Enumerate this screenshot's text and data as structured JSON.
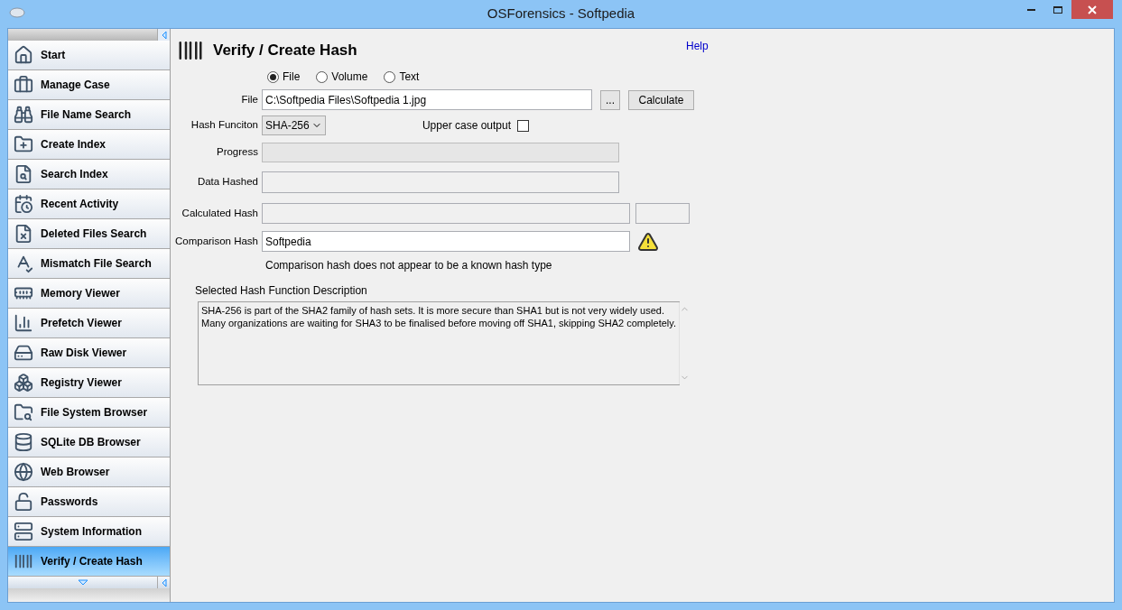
{
  "window": {
    "title": "OSForensics - Softpedia"
  },
  "sidebar": {
    "items": [
      {
        "label": "Start",
        "selected": false
      },
      {
        "label": "Manage Case",
        "selected": false
      },
      {
        "label": "File Name Search",
        "selected": false
      },
      {
        "label": "Create Index",
        "selected": false
      },
      {
        "label": "Search Index",
        "selected": false
      },
      {
        "label": "Recent Activity",
        "selected": false
      },
      {
        "label": "Deleted Files Search",
        "selected": false
      },
      {
        "label": "Mismatch File Search",
        "selected": false
      },
      {
        "label": "Memory Viewer",
        "selected": false
      },
      {
        "label": "Prefetch Viewer",
        "selected": false
      },
      {
        "label": "Raw Disk Viewer",
        "selected": false
      },
      {
        "label": "Registry Viewer",
        "selected": false
      },
      {
        "label": "File System Browser",
        "selected": false
      },
      {
        "label": "SQLite DB Browser",
        "selected": false
      },
      {
        "label": "Web Browser",
        "selected": false
      },
      {
        "label": "Passwords",
        "selected": false
      },
      {
        "label": "System Information",
        "selected": false
      },
      {
        "label": "Verify / Create Hash",
        "selected": true
      }
    ]
  },
  "page": {
    "title": "Verify / Create Hash",
    "help": "Help"
  },
  "source_options": [
    {
      "label": "File",
      "selected": true
    },
    {
      "label": "Volume",
      "selected": false
    },
    {
      "label": "Text",
      "selected": false
    }
  ],
  "file": {
    "label": "File",
    "value": "C:\\Softpedia Files\\Softpedia 1.jpg",
    "browse_button": "...",
    "calculate_button": "Calculate"
  },
  "hash_function": {
    "label": "Hash Funciton",
    "value": "SHA-256"
  },
  "upper_case_output": {
    "label": "Upper case output",
    "checked": false
  },
  "progress": {
    "label": "Progress",
    "level": 0
  },
  "data_hashed": {
    "label": "Data Hashed"
  },
  "calculated_hash": {
    "label": "Calculated Hash"
  },
  "comparison_hash": {
    "label": "Comparison Hash",
    "value": "Softpedia",
    "warning": "Comparison hash does not appear to be a known hash type"
  },
  "description": {
    "label": "Selected Hash Function Description",
    "lines": [
      "SHA-256 is part of the SHA2 family of hash sets. It is more secure than SHA1 but is not very widely used.",
      "Many organizations are waiting for SHA3 to be finalised before moving off SHA1, skipping SHA2 completely."
    ]
  }
}
